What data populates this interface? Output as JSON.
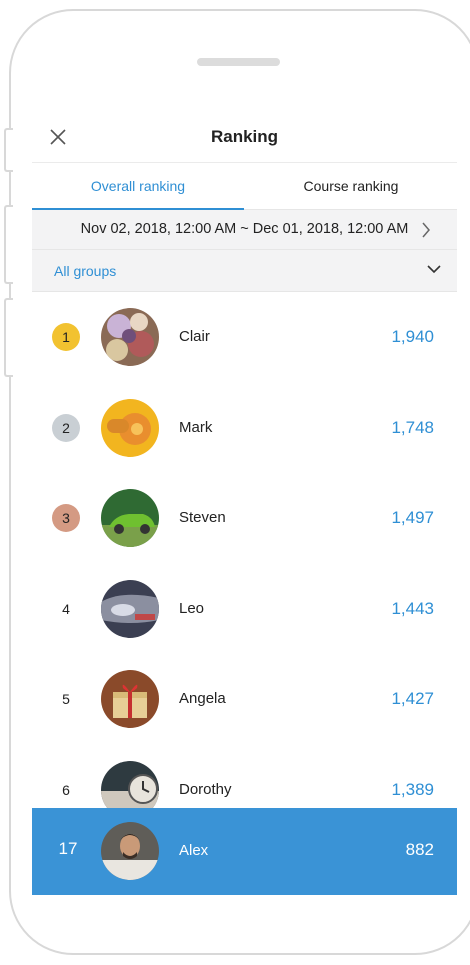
{
  "header": {
    "title": "Ranking",
    "close_icon": "close-icon"
  },
  "tabs": [
    {
      "label": "Overall ranking",
      "selected": true
    },
    {
      "label": "Course ranking",
      "selected": false
    }
  ],
  "date_range": {
    "text": "Nov 02, 2018, 12:00 AM ~ Dec 01, 2018, 12:00 AM",
    "next_icon": "chevron-right-icon"
  },
  "group_filter": {
    "label": "All groups",
    "icon": "chevron-down-icon"
  },
  "rankings": [
    {
      "rank": "1",
      "name": "Clair",
      "score": "1,940",
      "medal": "gold"
    },
    {
      "rank": "2",
      "name": "Mark",
      "score": "1,748",
      "medal": "silver"
    },
    {
      "rank": "3",
      "name": "Steven",
      "score": "1,497",
      "medal": "bronze"
    },
    {
      "rank": "4",
      "name": "Leo",
      "score": "1,443",
      "medal": ""
    },
    {
      "rank": "5",
      "name": "Angela",
      "score": "1,427",
      "medal": ""
    },
    {
      "rank": "6",
      "name": "Dorothy",
      "score": "1,389",
      "medal": ""
    }
  ],
  "current_user": {
    "rank": "17",
    "name": "Alex",
    "score": "882"
  },
  "colors": {
    "accent": "#2f8fd4",
    "highlight_row": "#3a93d6",
    "gold": "#f2c230",
    "silver": "#c9cfd4",
    "bronze": "#d49a83"
  }
}
